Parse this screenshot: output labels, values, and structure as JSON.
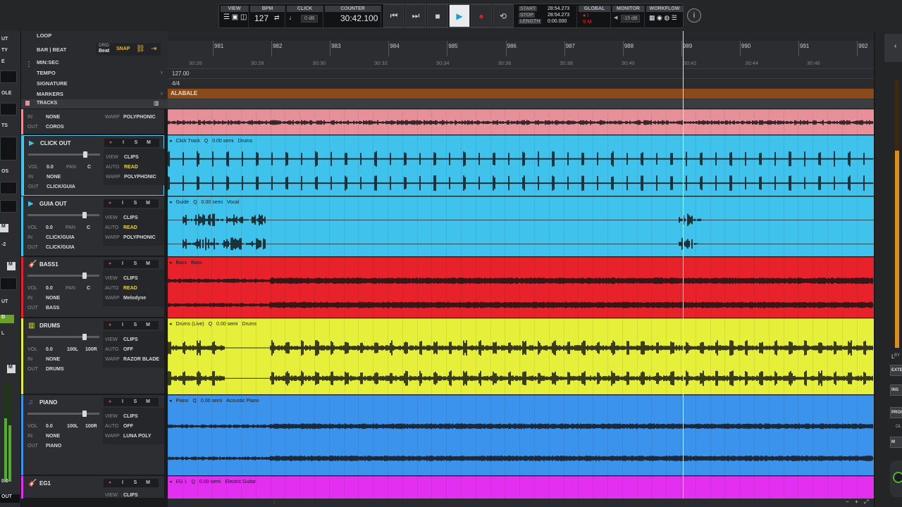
{
  "transport": {
    "view_label": "VIEW",
    "bpm_label": "BPM",
    "bpm_value": "127",
    "click_label": "CLICK",
    "click_level": "0 dB",
    "counter_label": "COUNTER",
    "counter_value": "30:42.100",
    "start_label": "START",
    "stop_label": "STOP",
    "length_label": "LENGTH",
    "start_value": "28:54.273",
    "stop_value": "28:54.273",
    "length_value": "0:00.000",
    "global_label": "GLOBAL",
    "monitor_label": "MONITOR",
    "monitor_level": "-15 dB",
    "workflow_label": "WORKFLOW",
    "play_active": true
  },
  "leftstrip": {
    "items": [
      "UT",
      "TY",
      "E",
      "OLE",
      "TS",
      "OS",
      "M",
      "-2",
      "M",
      "UT",
      "D",
      "L",
      "M",
      "0.0",
      "OUT"
    ]
  },
  "ruler": {
    "rows": [
      "LOOP",
      "BAR | BEAT",
      "MIN:SEC",
      "TEMPO",
      "SIGNATURE",
      "MARKERS",
      "TRACKS"
    ],
    "grid_label": "GRID",
    "grid_value": "Beat",
    "snap_label": "SNAP",
    "tempo_value": "127.00",
    "signature_value": "4/4",
    "marker_name": "ALABALE",
    "bars": [
      "981",
      "982",
      "983",
      "984",
      "985",
      "986",
      "987",
      "988",
      "989",
      "990",
      "991",
      "992"
    ],
    "times": [
      "30:26",
      "30:28",
      "30:30",
      "30:32",
      "30:34",
      "30:36",
      "30:38",
      "30:40",
      "30:42",
      "30:44",
      "30:46"
    ]
  },
  "tracks": [
    {
      "name": "",
      "color": "#e8909a",
      "fields": {
        "in": "NONE",
        "out": "COROS",
        "warp": "POLYPHONIC"
      },
      "lane_labels": []
    },
    {
      "name": "CLICK OUT",
      "color": "#3fc3ec",
      "selected": true,
      "fields": {
        "vol": "0.0",
        "pan": "C",
        "in": "NONE",
        "out": "CLICK/GUIA",
        "view": "CLIPS",
        "auto": "READ",
        "warp": "POLYPHONIC"
      },
      "lane_labels": [
        "Click Track",
        "Q",
        "0.00 semi",
        "Drums"
      ]
    },
    {
      "name": "GUIA OUT",
      "color": "#3fc3ec",
      "fields": {
        "vol": "0.0",
        "pan": "C",
        "in": "CLICK/GUIA",
        "out": "CLICK/GUIA",
        "view": "CLIPS",
        "auto": "READ",
        "warp": "POLYPHONIC"
      },
      "lane_labels": [
        "Guide",
        "Q",
        "0.00 semi",
        "Vocal"
      ]
    },
    {
      "name": "BASS1",
      "color": "#e8222a",
      "fields": {
        "vol": "0.0",
        "pan": "C",
        "in": "NONE",
        "out": "BASS",
        "view": "CLIPS",
        "auto": "READ",
        "warp": "Melodyne"
      },
      "lane_labels": [
        "Bass",
        "Bass"
      ]
    },
    {
      "name": "DRUMS",
      "color": "#e6f03a",
      "fields": {
        "vol": "0.0",
        "pan": "100L",
        "pan2": "100R",
        "in": "NONE",
        "out": "DRUMS",
        "view": "CLIPS",
        "auto": "OFF",
        "warp": "RAZOR BLADE"
      },
      "lane_labels": [
        "Drums (Live)",
        "Q",
        "0.00 semi",
        "Drums"
      ]
    },
    {
      "name": "PIANO",
      "color": "#3c93ec",
      "fields": {
        "vol": "0.0",
        "pan": "100L",
        "pan2": "100R",
        "in": "NONE",
        "out": "PIANO",
        "view": "CLIPS",
        "auto": "OFF",
        "warp": "LUNA POLY"
      },
      "lane_labels": [
        "Piano",
        "Q",
        "0.00 semi",
        "Acoustic Piano"
      ]
    },
    {
      "name": "EG1",
      "color": "#e22ff0",
      "fields": {
        "view": "CLIPS"
      },
      "lane_labels": [
        "EG 1",
        "Q",
        "0.00 semi",
        "Electric Guitar"
      ]
    }
  ],
  "track_buttons": [
    "I",
    "S",
    "M"
  ],
  "field_keys": {
    "vol": "VOL",
    "pan": "PAN",
    "in": "IN",
    "out": "OUT",
    "view": "VIEW",
    "auto": "AUTO",
    "warp": "WARP"
  },
  "rightpanel": {
    "buttons": [
      "EXTE",
      "INS",
      "PROC",
      "M"
    ],
    "labels": [
      "BY",
      "OL"
    ]
  }
}
